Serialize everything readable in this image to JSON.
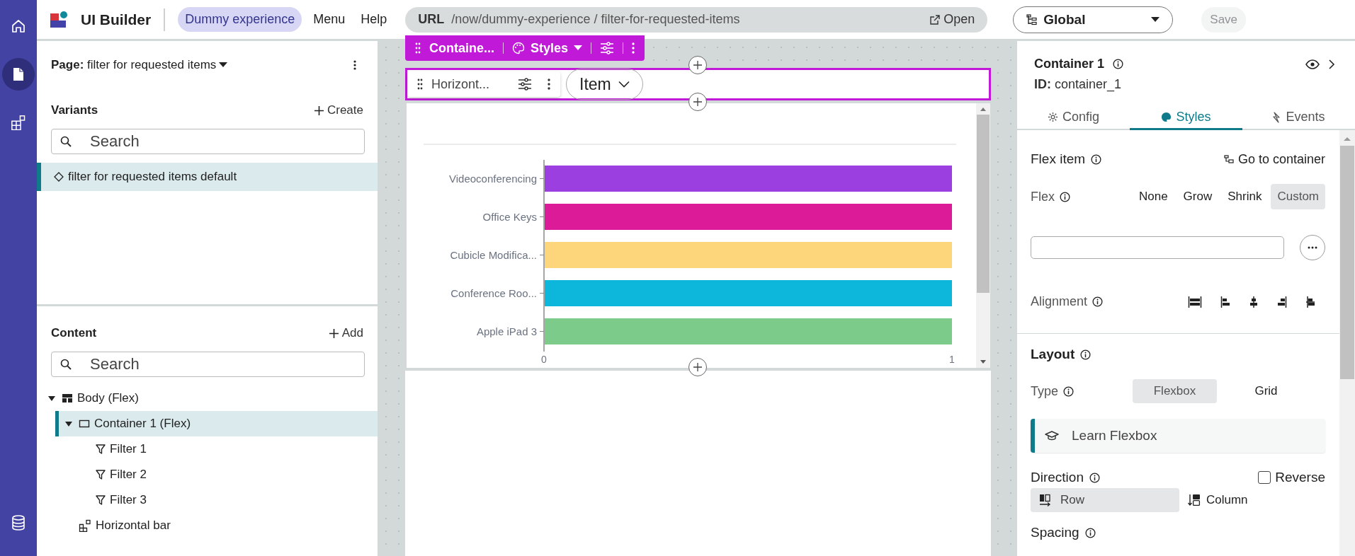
{
  "rail": {
    "items": [
      {
        "kind": "home",
        "selected": false
      },
      {
        "kind": "pages",
        "selected": true
      },
      {
        "kind": "components",
        "selected": false
      },
      {
        "kind": "data",
        "selected": false
      }
    ]
  },
  "header": {
    "app_title": "UI Builder",
    "experience": "Dummy experience",
    "menus": [
      "Menu",
      "Help"
    ],
    "url": {
      "label": "URL",
      "value": "/now/dummy-experience / filter-for-requested-items",
      "action": "Open"
    },
    "scope": "Global",
    "save": {
      "label": "Save",
      "disabled": true
    }
  },
  "left_panel": {
    "page": {
      "label": "Page:",
      "value": "filter for requested items"
    },
    "variants": {
      "title": "Variants",
      "action": "Create",
      "search_placeholder": "Search",
      "items": [
        {
          "label": "filter for requested items default",
          "selected": true
        }
      ]
    },
    "content": {
      "title": "Content",
      "action": "Add",
      "search_placeholder": "Search",
      "tree": [
        {
          "label": "Body (Flex)",
          "kind": "layout",
          "expanded": true,
          "selected": false,
          "children": [
            {
              "label": "Container 1 (Flex)",
              "kind": "container",
              "expanded": true,
              "selected": true,
              "children": [
                {
                  "label": "Filter 1",
                  "kind": "filter",
                  "selected": false
                },
                {
                  "label": "Filter 2",
                  "kind": "filter",
                  "selected": false
                },
                {
                  "label": "Filter 3",
                  "kind": "filter",
                  "selected": false
                }
              ]
            },
            {
              "label": "Horizontal bar",
              "kind": "component",
              "selected": false
            }
          ]
        }
      ]
    }
  },
  "canvas": {
    "container_toolbar": {
      "label": "Containe...",
      "styles": "Styles"
    },
    "component_toolbar": {
      "label": "Horizont..."
    },
    "filter_pill": "Item",
    "chart_data": {
      "type": "bar",
      "orientation": "horizontal",
      "categories": [
        "Videoconferencing",
        "Office Keys",
        "Cubicle Modifica...",
        "Conference Roo...",
        "Apple iPad 3"
      ],
      "values": [
        1,
        1,
        1,
        1,
        1
      ],
      "colors": [
        "#9b3fe0",
        "#dc1b98",
        "#fdd57a",
        "#0cb7db",
        "#7dcb8a"
      ],
      "xticks": [
        0,
        1
      ],
      "xlim": [
        0,
        1
      ]
    }
  },
  "properties": {
    "title": "Container 1",
    "id": "**ID:** container_1",
    "tabs": [
      {
        "label": "Config",
        "kind": "config",
        "selected": false
      },
      {
        "label": "Styles",
        "kind": "styles",
        "selected": true
      },
      {
        "label": "Events",
        "kind": "events",
        "selected": false
      }
    ],
    "flex_item": {
      "title": "Flex item",
      "link": "Go to container"
    },
    "flex": {
      "label": "Flex",
      "options": [
        {
          "label": "None",
          "selected": false
        },
        {
          "label": "Grow",
          "selected": false
        },
        {
          "label": "Shrink",
          "selected": false
        },
        {
          "label": "Custom",
          "selected": true
        }
      ]
    },
    "alignment": {
      "label": "Alignment",
      "options": [
        {
          "kind": "stretch"
        },
        {
          "kind": "start"
        },
        {
          "kind": "center"
        },
        {
          "kind": "end"
        },
        {
          "kind": "baseline"
        }
      ]
    },
    "layout": {
      "title": "Layout",
      "type_label": "Type",
      "types": [
        {
          "label": "Flexbox",
          "selected": true
        },
        {
          "label": "Grid",
          "selected": false
        }
      ],
      "learn": "Learn Flexbox",
      "direction_label": "Direction",
      "reverse": {
        "label": "Reverse",
        "checked": false
      },
      "directions": [
        {
          "label": "Row",
          "kind": "row",
          "selected": true
        },
        {
          "label": "Column",
          "kind": "column",
          "selected": false
        }
      ],
      "spacing_label": "Spacing"
    }
  }
}
